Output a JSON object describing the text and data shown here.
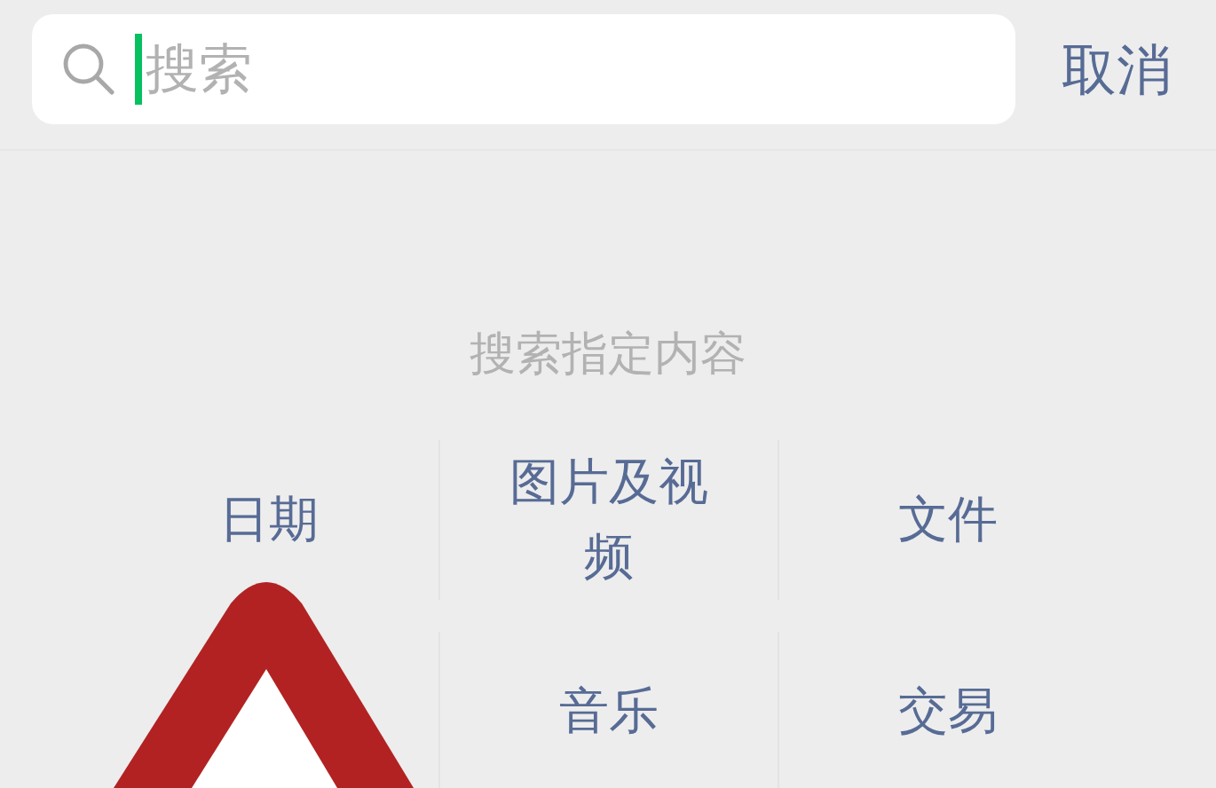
{
  "search": {
    "placeholder": "搜索",
    "focused": true
  },
  "cancel": "取消",
  "section_title": "搜索指定内容",
  "rows": [
    {
      "cells": [
        "日期",
        "图片及视频",
        "文件"
      ]
    },
    {
      "cells": [
        "音乐",
        "交易"
      ]
    }
  ],
  "overlay": {
    "kind": "warning-triangle"
  }
}
